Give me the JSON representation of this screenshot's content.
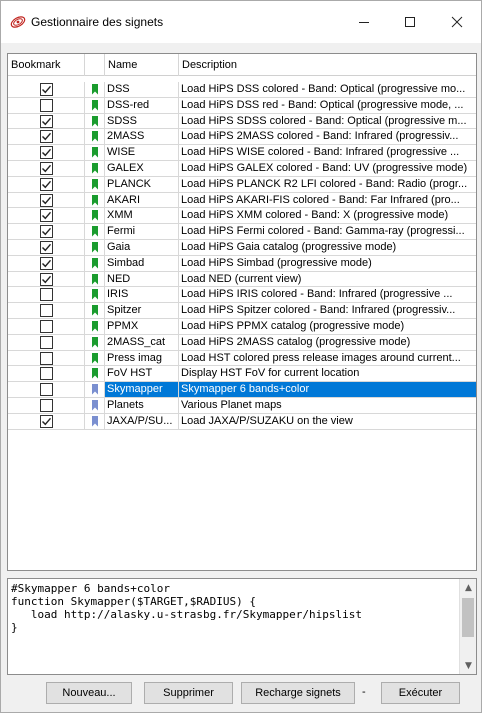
{
  "window": {
    "title": "Gestionnaire des signets",
    "controls": {
      "minimize": "—",
      "maximize": "☐",
      "close": "✕"
    }
  },
  "table": {
    "columns": [
      "Bookmark",
      "",
      "Name",
      "Description"
    ],
    "rows": [
      {
        "checked": true,
        "name": "DSS",
        "description": "Load HiPS DSS colored - Band: Optical (progressive mo...",
        "flag_color": "#1a9c2e"
      },
      {
        "checked": false,
        "name": "DSS-red",
        "description": "Load HiPS DSS red - Band: Optical (progressive mode, ...",
        "flag_color": "#1a9c2e"
      },
      {
        "checked": true,
        "name": "SDSS",
        "description": "Load HiPS SDSS colored - Band: Optical (progressive m...",
        "flag_color": "#1a9c2e"
      },
      {
        "checked": true,
        "name": "2MASS",
        "description": "Load HiPS 2MASS colored - Band: Infrared (progressiv...",
        "flag_color": "#1a9c2e"
      },
      {
        "checked": true,
        "name": "WISE",
        "description": "Load HiPS WISE colored - Band: Infrared (progressive ...",
        "flag_color": "#1a9c2e"
      },
      {
        "checked": true,
        "name": "GALEX",
        "description": "Load HiPS GALEX colored - Band: UV (progressive mode)",
        "flag_color": "#1a9c2e"
      },
      {
        "checked": true,
        "name": "PLANCK",
        "description": "Load HiPS PLANCK R2 LFI colored - Band: Radio (progr...",
        "flag_color": "#1a9c2e"
      },
      {
        "checked": true,
        "name": "AKARI",
        "description": "Load HiPS AKARI-FIS colored - Band: Far Infrared (pro...",
        "flag_color": "#1a9c2e"
      },
      {
        "checked": true,
        "name": "XMM",
        "description": "Load HiPS XMM colored - Band: X (progressive mode)",
        "flag_color": "#1a9c2e"
      },
      {
        "checked": true,
        "name": "Fermi",
        "description": "Load HiPS Fermi colored - Band: Gamma-ray (progressi...",
        "flag_color": "#1a9c2e"
      },
      {
        "checked": true,
        "name": "Gaia",
        "description": "Load HiPS Gaia catalog (progressive mode)",
        "flag_color": "#1a9c2e"
      },
      {
        "checked": true,
        "name": "Simbad",
        "description": "Load HiPS Simbad (progressive mode)",
        "flag_color": "#1a9c2e"
      },
      {
        "checked": true,
        "name": "NED",
        "description": "Load NED (current view)",
        "flag_color": "#1a9c2e"
      },
      {
        "checked": false,
        "name": "IRIS",
        "description": "Load HiPS IRIS colored - Band: Infrared (progressive ...",
        "flag_color": "#1a9c2e"
      },
      {
        "checked": false,
        "name": "Spitzer",
        "description": "Load HiPS Spitzer colored - Band: Infrared (progressiv...",
        "flag_color": "#1a9c2e"
      },
      {
        "checked": false,
        "name": "PPMX",
        "description": "Load HiPS PPMX catalog (progressive mode)",
        "flag_color": "#1a9c2e"
      },
      {
        "checked": false,
        "name": "2MASS_cat",
        "description": "Load HiPS 2MASS catalog (progressive mode)",
        "flag_color": "#1a9c2e"
      },
      {
        "checked": false,
        "name": "Press imag",
        "description": "Load HST colored press release images around current...",
        "flag_color": "#1a9c2e"
      },
      {
        "checked": false,
        "name": "FoV HST",
        "description": "Display HST FoV for current location",
        "flag_color": "#1a9c2e"
      },
      {
        "checked": false,
        "name": "Skymapper",
        "description": "Skymapper 6 bands+color",
        "flag_color": "#7a8fd0",
        "selected": true
      },
      {
        "checked": false,
        "name": "Planets",
        "description": "Various Planet maps",
        "flag_color": "#7a8fd0"
      },
      {
        "checked": true,
        "name": "JAXA/P/SU...",
        "description": "Load JAXA/P/SUZAKU on the view",
        "flag_color": "#7a8fd0"
      }
    ]
  },
  "editor": {
    "code": "#Skymapper 6 bands+color\nfunction Skymapper($TARGET,$RADIUS) {\n   load http://alasky.u-strasbg.fr/Skymapper/hipslist\n}"
  },
  "buttons": {
    "new": "Nouveau...",
    "delete": "Supprimer",
    "reload": "Recharge signets",
    "separator": "-",
    "execute": "Exécuter"
  },
  "colors": {
    "selection": "#0078d7",
    "default_flag": "#1a9c2e",
    "user_flag": "#7a8fd0"
  }
}
